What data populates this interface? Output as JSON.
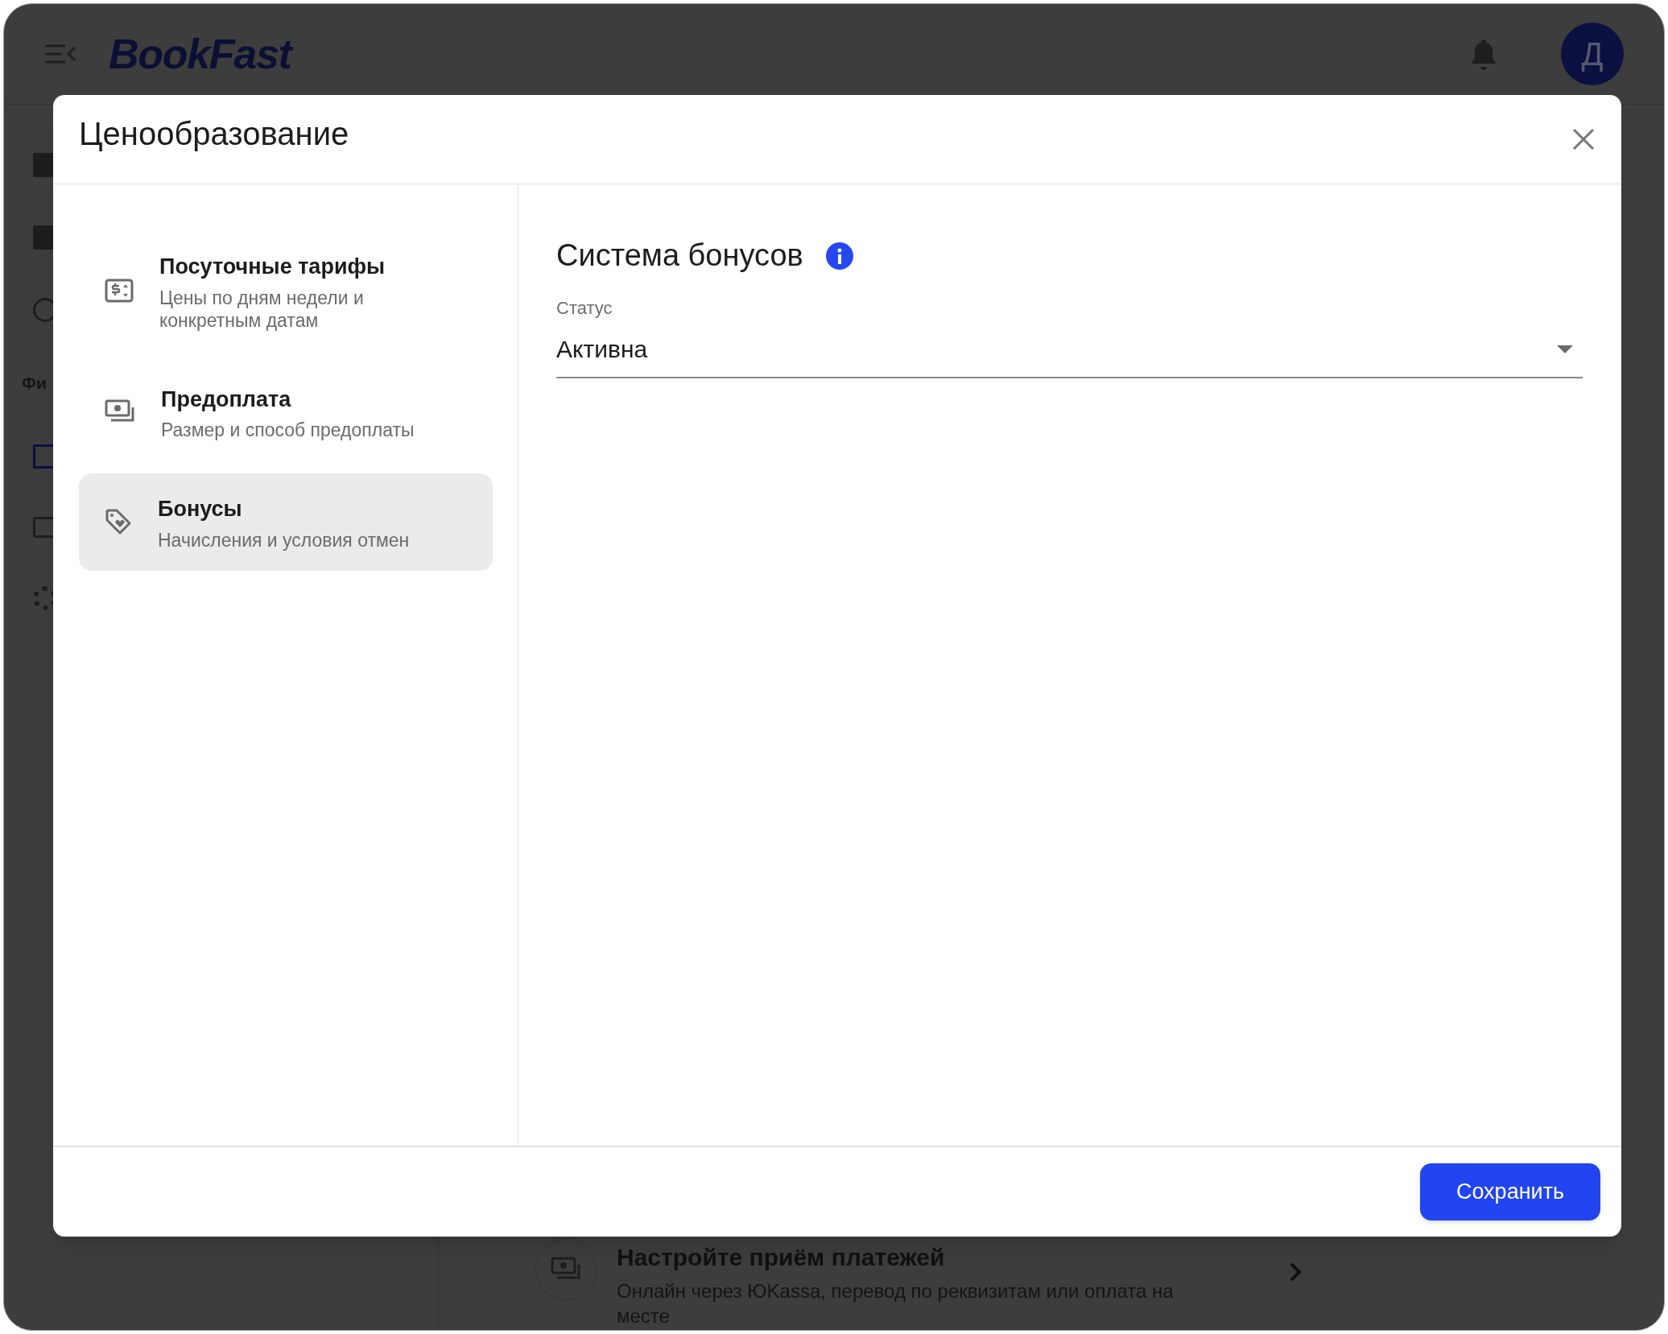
{
  "app_bar": {
    "logo": "BookFast",
    "avatar_initial": "Д"
  },
  "sidebar": {
    "section_label": "Фи"
  },
  "background_card": {
    "title": "Настройте приём платежей",
    "subtitle": "Онлайн через ЮKassa, перевод по реквизитам или оплата на месте"
  },
  "dialog": {
    "title": "Ценообразование",
    "nav_items": [
      {
        "kind": "rates",
        "title": "Посуточные тарифы",
        "subtitle": "Цены по дням недели и конкретным датам",
        "selected": false
      },
      {
        "kind": "prepayment",
        "title": "Предоплата",
        "subtitle": "Размер и способ предоплаты",
        "selected": false
      },
      {
        "kind": "bonuses",
        "title": "Бонусы",
        "subtitle": "Начисления и условия отмен",
        "selected": true
      }
    ],
    "section": {
      "title": "Система бонусов",
      "status_field": {
        "label": "Статус",
        "value": "Активна"
      }
    },
    "save_button": "Сохранить"
  }
}
